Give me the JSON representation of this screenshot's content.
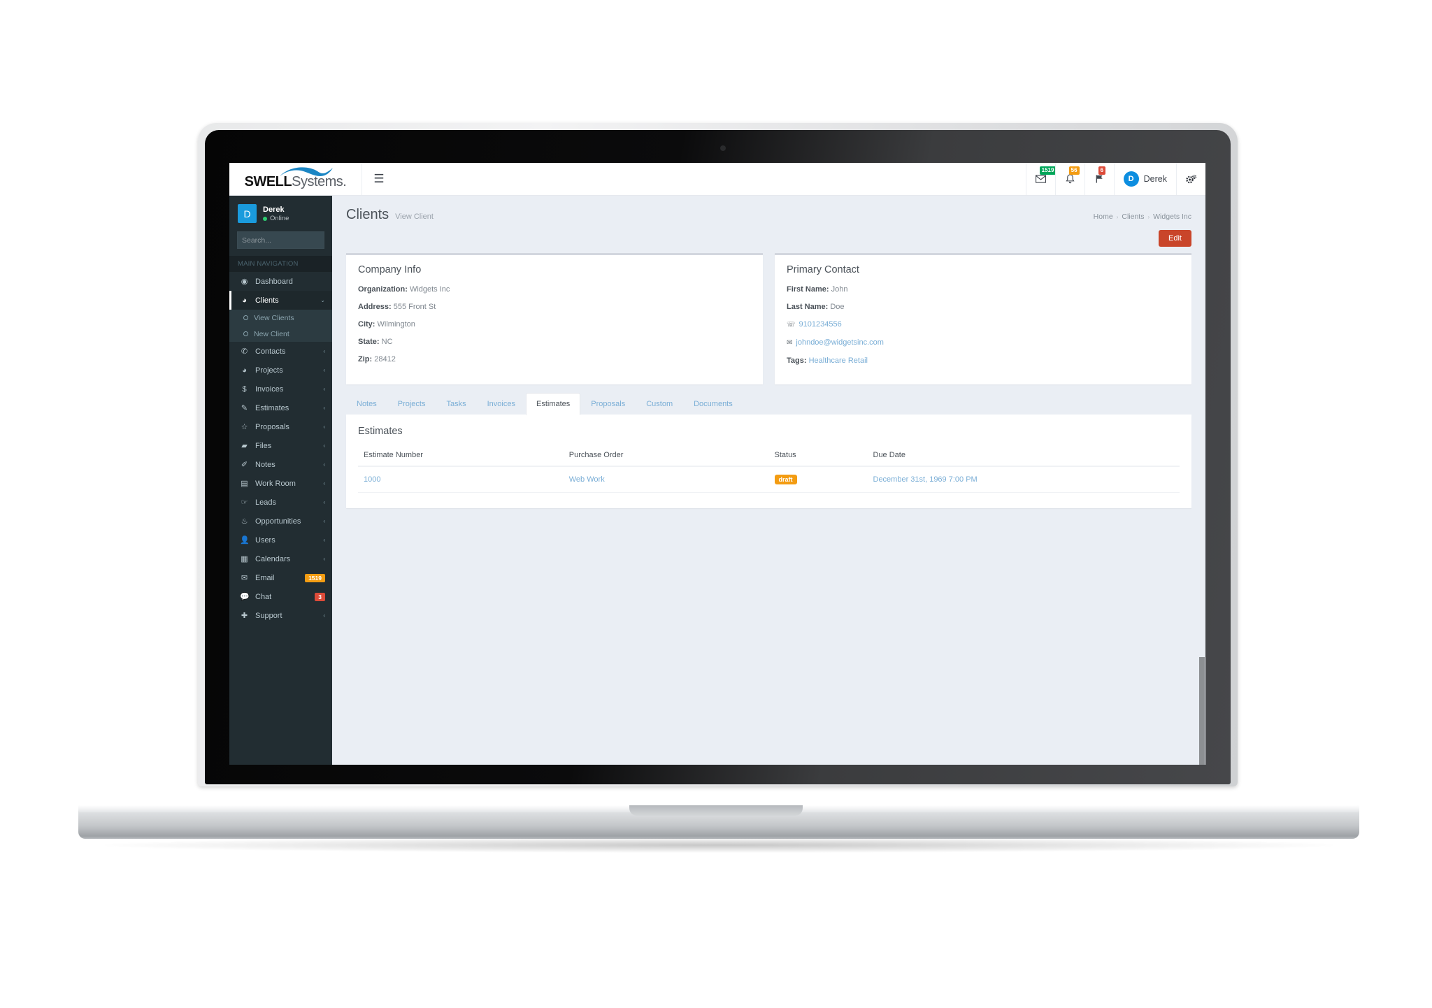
{
  "brand": {
    "bold": "SWELL",
    "light": "Systems.",
    "hamburger_icon": "hamburger-icon"
  },
  "topbar": {
    "mail_icon": "envelope-icon",
    "mail_badge": "1519",
    "bell_icon": "bell-icon",
    "bell_badge": "56",
    "flag_icon": "flag-icon",
    "flag_badge": "6",
    "avatar_initial": "D",
    "user_name": "Derek",
    "settings_icon": "gear-settings-icon",
    "badge_green": "#00a65a",
    "badge_yellow": "#f39c12",
    "badge_red": "#dd4b39"
  },
  "sidebar": {
    "avatar_initial": "D",
    "user_name": "Derek",
    "status": "Online",
    "search_placeholder": "Search...",
    "search_value": "",
    "search_icon": "search-icon",
    "nav_header": "MAIN NAVIGATION",
    "items": [
      {
        "label": "Dashboard",
        "icon": "dashboard-icon",
        "glyph": "◉",
        "arrow": "",
        "badge": "",
        "active": false
      },
      {
        "label": "Clients",
        "icon": "globe-icon",
        "glyph": "◕",
        "arrow": "⌄",
        "badge": "",
        "active": true
      },
      {
        "label": "Contacts",
        "icon": "phone-icon",
        "glyph": "✆",
        "arrow": "‹",
        "badge": "",
        "active": false
      },
      {
        "label": "Projects",
        "icon": "pie-chart-icon",
        "glyph": "◕",
        "arrow": "‹",
        "badge": "",
        "active": false
      },
      {
        "label": "Invoices",
        "icon": "dollar-icon",
        "glyph": "$",
        "arrow": "‹",
        "badge": "",
        "active": false
      },
      {
        "label": "Estimates",
        "icon": "edit-square-icon",
        "glyph": "✎",
        "arrow": "‹",
        "badge": "",
        "active": false
      },
      {
        "label": "Proposals",
        "icon": "star-icon",
        "glyph": "☆",
        "arrow": "‹",
        "badge": "",
        "active": false
      },
      {
        "label": "Files",
        "icon": "folder-icon",
        "glyph": "▰",
        "arrow": "‹",
        "badge": "",
        "active": false
      },
      {
        "label": "Notes",
        "icon": "pencil-icon",
        "glyph": "✐",
        "arrow": "‹",
        "badge": "",
        "active": false
      },
      {
        "label": "Work Room",
        "icon": "desktop-icon",
        "glyph": "▤",
        "arrow": "‹",
        "badge": "",
        "active": false
      },
      {
        "label": "Leads",
        "icon": "hand-pointer-icon",
        "glyph": "☞",
        "arrow": "‹",
        "badge": "",
        "active": false
      },
      {
        "label": "Opportunities",
        "icon": "fire-icon",
        "glyph": "♨",
        "arrow": "‹",
        "badge": "",
        "active": false
      },
      {
        "label": "Users",
        "icon": "user-icon",
        "glyph": "👤",
        "arrow": "‹",
        "badge": "",
        "active": false
      },
      {
        "label": "Calendars",
        "icon": "calendar-icon",
        "glyph": "▦",
        "arrow": "‹",
        "badge": "",
        "active": false
      },
      {
        "label": "Email",
        "icon": "envelope-icon",
        "glyph": "✉",
        "arrow": "",
        "badge": "1519",
        "badge_color": "yellow",
        "active": false
      },
      {
        "label": "Chat",
        "icon": "comments-icon",
        "glyph": "💬",
        "arrow": "",
        "badge": "3",
        "badge_color": "red",
        "active": false
      },
      {
        "label": "Support",
        "icon": "lifebuoy-icon",
        "glyph": "✚",
        "arrow": "‹",
        "badge": "",
        "active": false
      }
    ],
    "subitems": [
      {
        "label": "View Clients"
      },
      {
        "label": "New Client"
      }
    ]
  },
  "page": {
    "title": "Clients",
    "subtitle": "View Client",
    "breadcrumb": [
      {
        "label": "Home",
        "type": "link"
      },
      {
        "label": "Clients",
        "type": "link"
      },
      {
        "label": "Widgets Inc",
        "type": "current"
      }
    ],
    "breadcrumb_sep": "›",
    "edit_label": "Edit",
    "edit_color": "#c9452a"
  },
  "company_info": {
    "title": "Company Info",
    "fields": [
      {
        "label": "Organization:",
        "value": "Widgets Inc"
      },
      {
        "label": "Address:",
        "value": "555 Front St"
      },
      {
        "label": "City:",
        "value": "Wilmington"
      },
      {
        "label": "State:",
        "value": "NC"
      },
      {
        "label": "Zip:",
        "value": "28412"
      }
    ]
  },
  "primary_contact": {
    "title": "Primary Contact",
    "first_name_label": "First Name:",
    "first_name": "John",
    "last_name_label": "Last Name:",
    "last_name": "Doe",
    "phone_icon": "phone-icon",
    "phone": "9101234556",
    "email_icon": "envelope-icon",
    "email": "johndoe@widgetsinc.com",
    "tags_label": "Tags:",
    "tags": "Healthcare Retail"
  },
  "tabs": [
    {
      "label": "Notes",
      "active": false
    },
    {
      "label": "Projects",
      "active": false
    },
    {
      "label": "Tasks",
      "active": false
    },
    {
      "label": "Invoices",
      "active": false
    },
    {
      "label": "Estimates",
      "active": true
    },
    {
      "label": "Proposals",
      "active": false
    },
    {
      "label": "Custom",
      "active": false
    },
    {
      "label": "Documents",
      "active": false
    }
  ],
  "panel": {
    "title": "Estimates",
    "columns": [
      "Estimate Number",
      "Purchase Order",
      "Status",
      "Due Date"
    ],
    "rows": [
      {
        "estimate_number": "1000",
        "purchase_order": "Web Work",
        "status": "draft",
        "status_color": "#f39c12",
        "due_date": "December 31st, 1969 7:00 PM"
      }
    ]
  }
}
